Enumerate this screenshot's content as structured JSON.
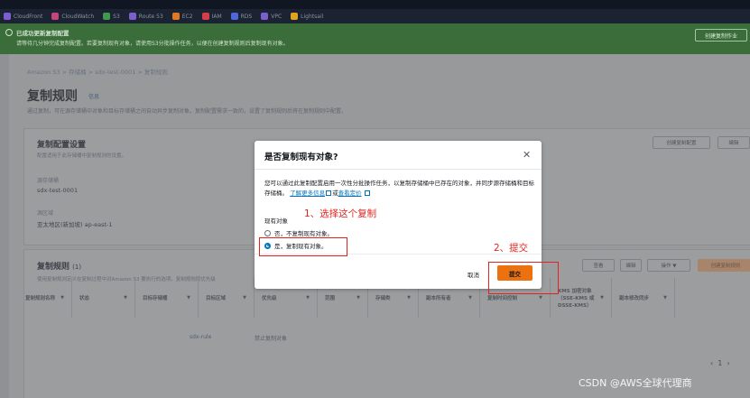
{
  "bookmarks": [
    {
      "label": "CloudFront",
      "color": "#7b5fd1"
    },
    {
      "label": "CloudWatch",
      "color": "#c7457a"
    },
    {
      "label": "S3",
      "color": "#3f9a4b"
    },
    {
      "label": "Route 53",
      "color": "#7b5fd1"
    },
    {
      "label": "EC2",
      "color": "#e07a1f"
    },
    {
      "label": "IAM",
      "color": "#d33f49"
    },
    {
      "label": "RDS",
      "color": "#4f67d8"
    },
    {
      "label": "VPC",
      "color": "#7b5fd1"
    },
    {
      "label": "Lightsail",
      "color": "#e0a31f"
    }
  ],
  "flash": {
    "title": "已成功更新复制配置",
    "text": "请等待几分钟完成复制配置。若要复制现有对象，请使用S3分批操作任务，以便在创建复制规则后复制现有对象。",
    "button": "创建复制作业"
  },
  "page": {
    "breadcrumbs": "Amazon S3  >  存储桶  >  sdx-test-0001  >  复制规则",
    "title": "复制规则",
    "title_info": "信息",
    "description": "通过复制，可在源存储桶中对象和目标存储桶之间自动异步复制对象。复制配置需求一致的，设置了复制规则后将在复制规则中配置。"
  },
  "panel_config": {
    "title": "复制配置设置",
    "subtitle": "配置适用于此存储桶中复制规则的设置。",
    "source_label": "源存储桶",
    "source_value": "sdx-test-0001",
    "region_label": "源区域",
    "region_value": "亚太地区(新加坡) ap-east-1",
    "btn_edit_config": "创建复制配置",
    "btn_edit": "编辑"
  },
  "panel_rules": {
    "title": "复制规则",
    "count": "(1)",
    "subtitle": "使用复制规则定义在复制过程中对Amazon S3 要执行的选项。复制规则按优先级",
    "btn_view": "查看",
    "btn_edit": "编辑",
    "btn_actions": "操作 ▼",
    "btn_create": "创建复制规则",
    "pager_page": "1",
    "columns": [
      {
        "label": "复制规则名称",
        "w": 60
      },
      {
        "label": "状态",
        "w": 70
      },
      {
        "label": "目标存储桶",
        "w": 70
      },
      {
        "label": "目标区域",
        "w": 62
      },
      {
        "label": "优先级",
        "w": 70
      },
      {
        "label": "范围",
        "w": 56
      },
      {
        "label": "存储类",
        "w": 56
      },
      {
        "label": "副本所有者",
        "w": 68
      },
      {
        "label": "复制时间控制",
        "w": 78
      },
      {
        "label": "KMS 加密对象（SSE-KMS 或 DSSE-KMS）",
        "w": 68
      },
      {
        "label": "副本修改同步",
        "w": 70
      }
    ],
    "row_name": "sdx-rule",
    "row_status": "禁止复制对象"
  },
  "modal": {
    "title": "是否复制现有对象?",
    "body": "您可以通过此复制配置启用一次性分批操作任务，以复制存储桶中已存在的对象，并同步源存储桶和目标存储桶。",
    "link_learn": "了解更多信息",
    "link_conj": "或",
    "link_pricing": "查看定价",
    "field_label": "现有对象",
    "option_no": "否，不复制现有对象。",
    "option_yes": "是，复制现有对象。",
    "cancel": "取消",
    "submit": "提交"
  },
  "annotations": {
    "step1": "1、选择这个复制",
    "step2": "2、提交",
    "color": "#e0231f"
  },
  "watermark": "CSDN @AWS全球代理商"
}
